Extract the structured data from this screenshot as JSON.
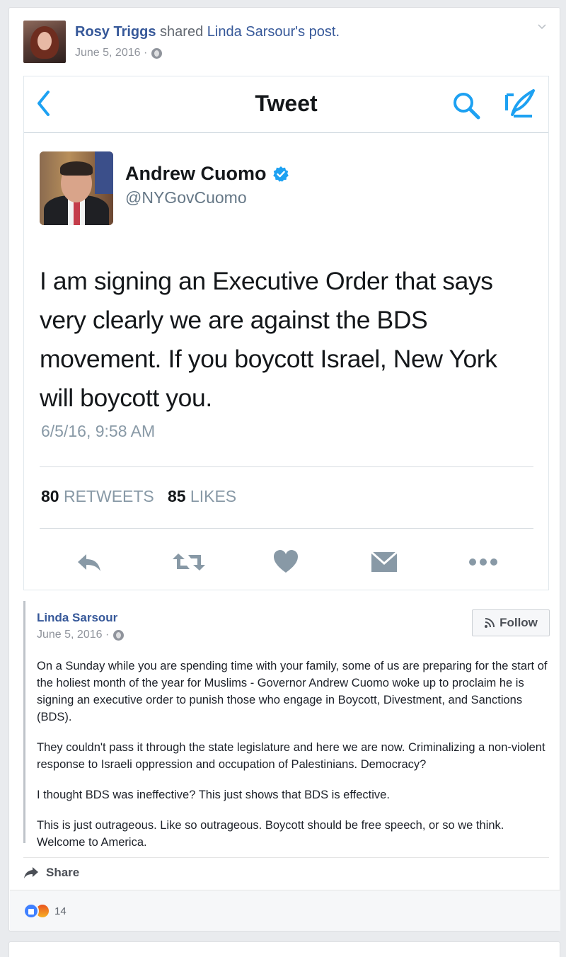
{
  "post": {
    "author": "Rosy Triggs",
    "action": "shared",
    "shared_from": "Linda Sarsour's post.",
    "date": "June 5, 2016 ·",
    "privacy_icon": "globe-icon"
  },
  "tweet": {
    "screen_title": "Tweet",
    "name": "Andrew Cuomo",
    "handle": "@NYGovCuomo",
    "text": "I am signing an Executive Order that says very clearly we are against the BDS movement. If you boycott Israel, New York will boycott you.",
    "time": "6/5/16, 9:58 AM",
    "retweets_count": "80",
    "retweets_label": "RETWEETS",
    "likes_count": "85",
    "likes_label": "LIKES",
    "accent": "#1da1f2"
  },
  "shared_post": {
    "author": "Linda Sarsour",
    "date": "June 5, 2016 ·",
    "follow_label": "Follow",
    "paragraphs": [
      "On a Sunday while you are spending time with your family, some of us are preparing for the start of the holiest month of the year for Muslims - Governor Andrew Cuomo woke up to proclaim he is signing an executive order to punish those who engage in Boycott, Divestment, and Sanctions (BDS).",
      "They couldn't pass it through the state legislature and here we are now. Criminalizing a non-violent response to Israeli oppression and occupation of Palestinians. Democracy?",
      "I thought BDS was ineffective? This just shows that BDS is effective.",
      "This is just outrageous. Like so outrageous. Boycott should be free speech, or so we think. Welcome to America."
    ]
  },
  "actions": {
    "share_label": "Share"
  },
  "reactions": {
    "count": "14",
    "types": [
      "like",
      "angry"
    ]
  }
}
